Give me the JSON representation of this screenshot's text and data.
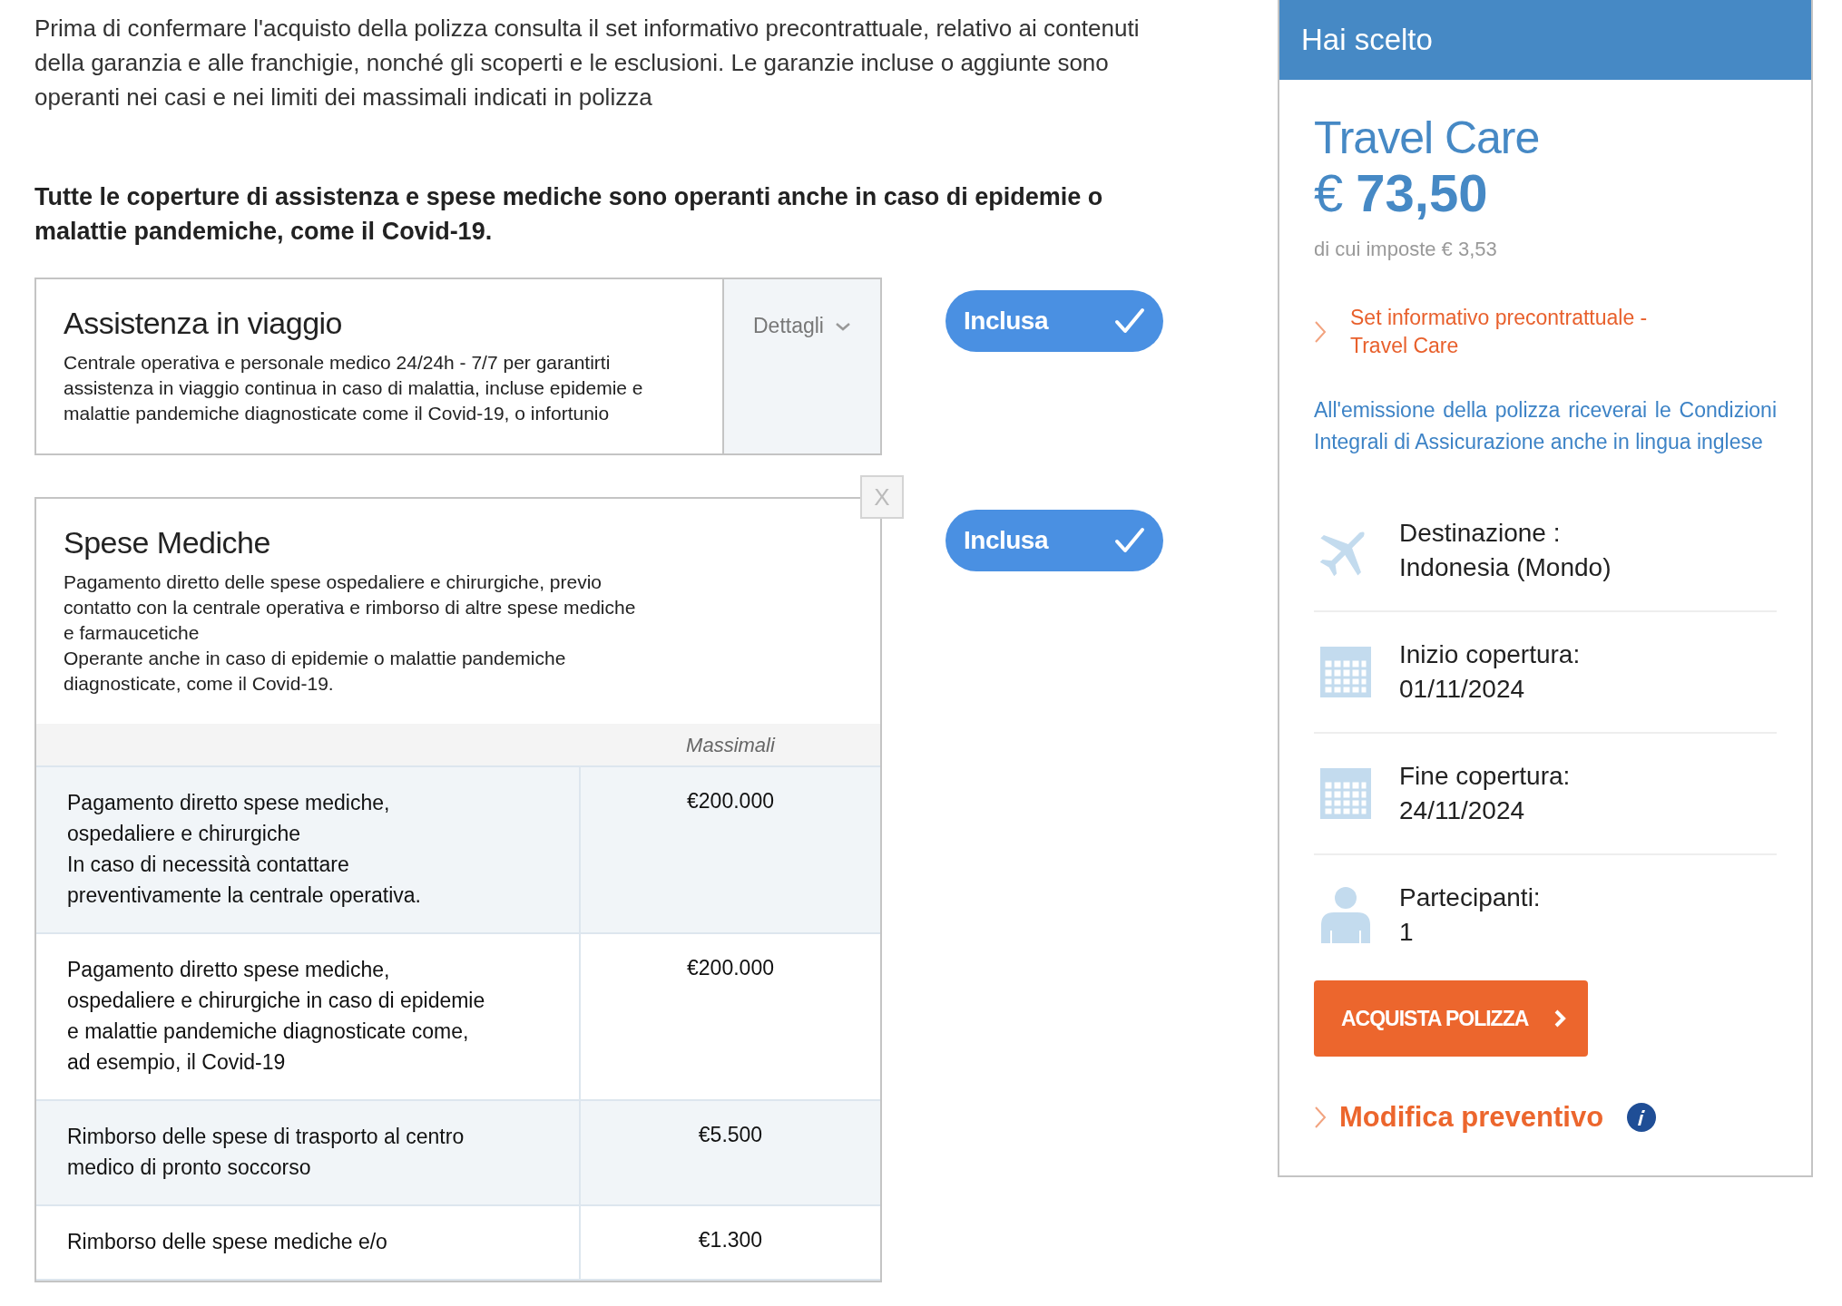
{
  "intro": "Prima di confermare l'acquisto della polizza consulta il set informativo precontrattuale, relativo ai contenuti della garanzia e alle franchigie, nonché gli scoperti e le esclusioni. Le garanzie incluse o aggiunte sono operanti nei casi e nei limiti dei massimali indicati in polizza",
  "notice": "Tutte le coperture di assistenza e spese mediche sono operanti anche in caso di epidemie o malattie pandemiche, come il Covid-19.",
  "coverages": [
    {
      "kind": "collapsed",
      "title": "Assistenza in viaggio",
      "description": "Centrale operativa e personale medico 24/24h - 7/7 per garantirti assistenza in viaggio continua in caso di malattia, incluse epidemie e malattie pandemiche diagnosticate come il Covid-19, o infortunio",
      "details_label": "Dettagli",
      "status": "Inclusa",
      "included": true
    },
    {
      "kind": "expanded",
      "title": "Spese Mediche",
      "description": "Pagamento diretto delle spese ospedaliere e chirurgiche, previo contatto con la centrale operativa e rimborso di altre spese mediche e farmaucetiche\nOperante anche in caso di epidemie o malattie pandemiche diagnosticate, come il Covid-19.",
      "close_label": "X",
      "status": "Inclusa",
      "included": true,
      "table": {
        "column_header": "Massimali",
        "rows": [
          {
            "description": "Pagamento diretto spese mediche,\nospedaliere e chirurgiche\nIn caso di necessità contattare\npreventivamente la centrale operativa.",
            "limit": "€200.000"
          },
          {
            "description": "Pagamento diretto spese mediche,\nospedaliere e chirurgiche in caso di epidemie\ne malattie pandemiche diagnosticate come,\nad esempio, il Covid-19",
            "limit": "€200.000"
          },
          {
            "description": "Rimborso delle spese di trasporto al centro\nmedico di pronto soccorso",
            "limit": "€5.500"
          },
          {
            "description": "Rimborso delle spese mediche e/o",
            "limit": "€1.300"
          }
        ]
      }
    }
  ],
  "summary": {
    "header": "Hai scelto",
    "product": "Travel Care",
    "currency": "€",
    "price": "73,50",
    "taxes": "di cui imposte € 3,53",
    "document_link": "Set informativo precontrattuale - Travel Care",
    "note": "All'emissione della polizza riceverai le Condizioni Integrali di Assicurazione anche in lingua inglese",
    "details": [
      {
        "kind": "plane",
        "label": "Destinazione :",
        "value": "Indonesia (Mondo)"
      },
      {
        "kind": "calendar",
        "label": "Inizio copertura:",
        "value": "01/11/2024"
      },
      {
        "kind": "calendar",
        "label": "Fine copertura:",
        "value": "24/11/2024"
      },
      {
        "kind": "person",
        "label": "Partecipanti:",
        "value": "1"
      }
    ],
    "buy_button": "ACQUISTA POLIZZA",
    "edit_link": "Modifica preventivo"
  }
}
